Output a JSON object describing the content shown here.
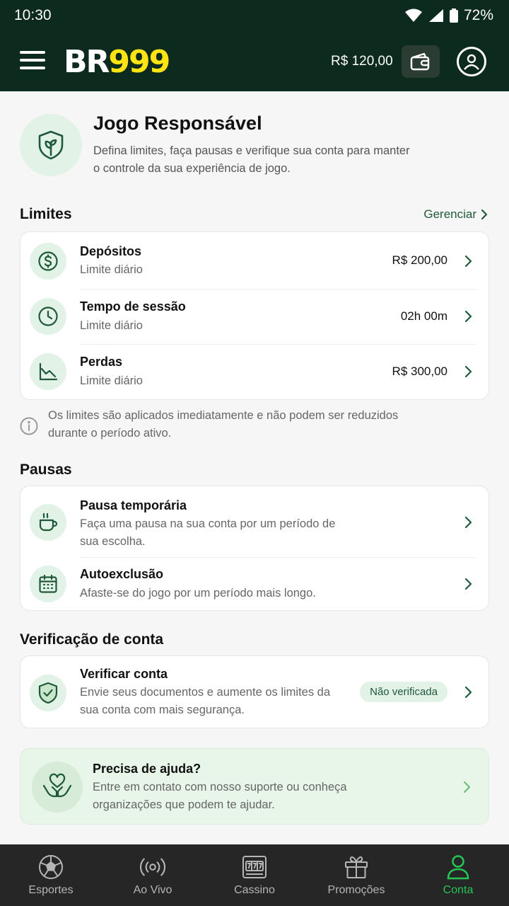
{
  "status_bar": {
    "time": "10:30",
    "battery": "72%"
  },
  "header": {
    "logo_br": "BR",
    "logo_nine": "999",
    "balance": "R$ 120,00"
  },
  "hero": {
    "title": "Jogo Responsável",
    "description": "Defina limites, faça pausas e verifique sua conta para manter o controle da sua experiência de jogo."
  },
  "limits": {
    "title": "Limites",
    "manage_label": "Gerenciar",
    "items": [
      {
        "title": "Depósitos",
        "subtitle": "Limite diário",
        "value": "R$ 200,00",
        "icon": "dollar-icon"
      },
      {
        "title": "Tempo de sessão",
        "subtitle": "Limite diário",
        "value": "02h 00m",
        "icon": "clock-icon"
      },
      {
        "title": "Perdas",
        "subtitle": "Limite diário",
        "value": "R$ 300,00",
        "icon": "chart-down-icon"
      }
    ],
    "note": "Os limites são aplicados imediatamente e não podem ser reduzidos durante o período ativo."
  },
  "pauses": {
    "title": "Pausas",
    "items": [
      {
        "title": "Pausa temporária",
        "subtitle": "Faça uma pausa na sua conta por um período de sua escolha.",
        "icon": "coffee-icon"
      },
      {
        "title": "Autoexclusão",
        "subtitle": "Afaste-se do jogo por um período mais longo.",
        "icon": "calendar-icon"
      }
    ]
  },
  "verification": {
    "title": "Verificação de conta",
    "item": {
      "title": "Verificar conta",
      "subtitle": "Envie seus documentos e aumente os limites da sua conta com mais segurança.",
      "badge": "Não verificada",
      "icon": "shield-check-icon"
    }
  },
  "help": {
    "title": "Precisa de ajuda?",
    "subtitle": "Entre em contato com nosso suporte ou conheça organizações que podem te ajudar.",
    "icon": "hands-heart-icon"
  },
  "tabbar": {
    "tabs": [
      {
        "label": "Esportes",
        "icon": "soccer-ball-icon"
      },
      {
        "label": "Ao Vivo",
        "icon": "broadcast-icon"
      },
      {
        "label": "Cassino",
        "icon": "slot-machine-icon"
      },
      {
        "label": "Promoções",
        "icon": "gift-icon"
      },
      {
        "label": "Conta",
        "icon": "user-icon"
      }
    ],
    "active": "Conta"
  },
  "colors": {
    "header_bg": "#0c2a1e",
    "accent_green": "#26c455",
    "logo_yellow": "#ffe414",
    "icon_green": "#1e5a3a"
  }
}
